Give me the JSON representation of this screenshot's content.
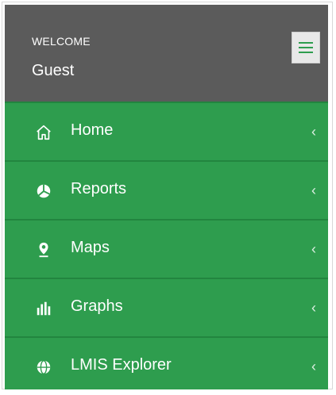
{
  "header": {
    "welcome": "WELCOME",
    "user": "Guest",
    "menu_icon": "hamburger-icon"
  },
  "menu": {
    "items": [
      {
        "label": "Home",
        "icon": "home-icon",
        "chevron": "‹"
      },
      {
        "label": "Reports",
        "icon": "pie-chart-icon",
        "chevron": "‹"
      },
      {
        "label": "Maps",
        "icon": "map-pin-icon",
        "chevron": "‹"
      },
      {
        "label": "Graphs",
        "icon": "bar-chart-icon",
        "chevron": "‹"
      },
      {
        "label": "LMIS Explorer",
        "icon": "globe-icon",
        "chevron": "‹"
      }
    ]
  },
  "colors": {
    "header_bg": "#5b5b5b",
    "menu_bg": "#2e9d4e",
    "divider": "#22853f"
  }
}
